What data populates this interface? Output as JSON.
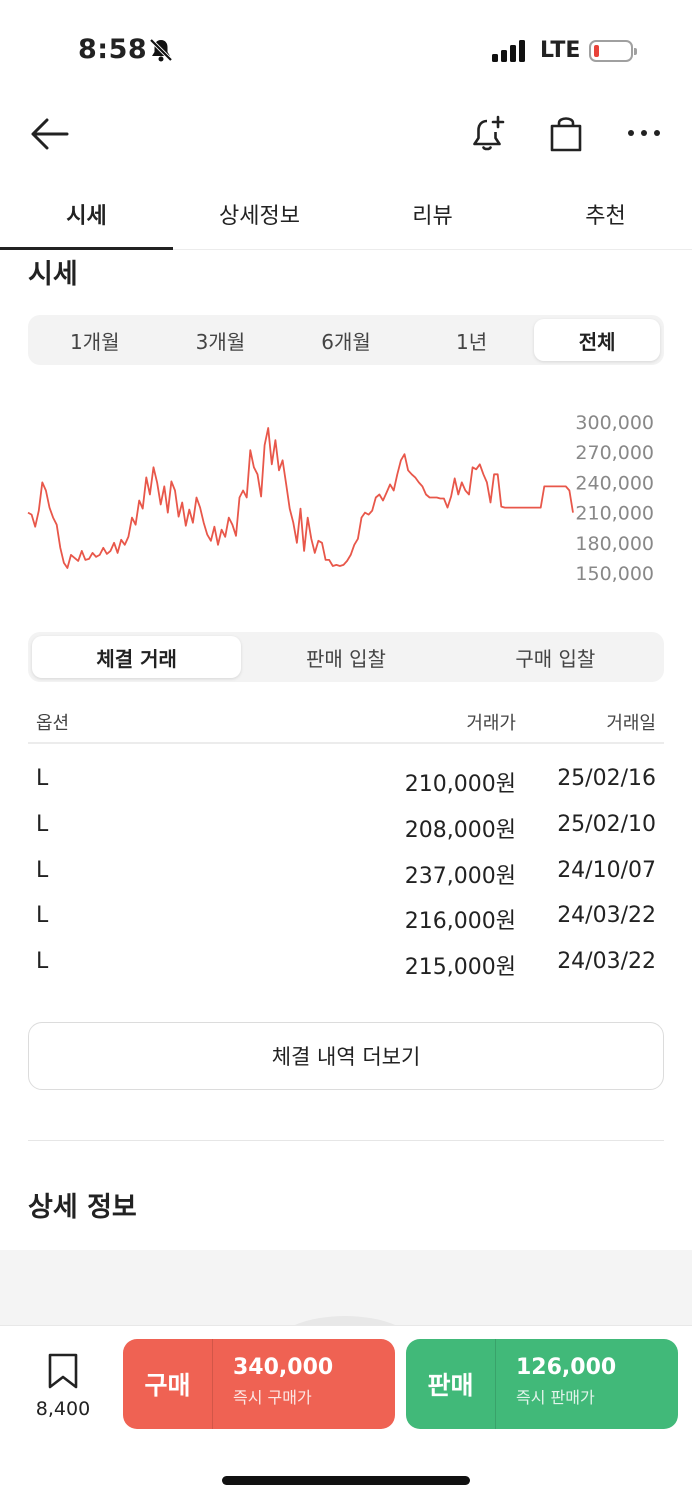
{
  "status": {
    "time": "8:58",
    "network": "LTE"
  },
  "colors": {
    "accent_red": "#ef6253",
    "accent_green": "#41b979",
    "chart_line": "#e8574a"
  },
  "icons": [
    "back-arrow-icon",
    "bell-plus-icon",
    "shopping-bag-icon",
    "more-icon",
    "bookmark-icon",
    "bell-off-icon"
  ],
  "tabs": [
    {
      "label": "시세",
      "active": true
    },
    {
      "label": "상세정보",
      "active": false
    },
    {
      "label": "리뷰",
      "active": false
    },
    {
      "label": "추천",
      "active": false
    }
  ],
  "price_section": {
    "title": "시세"
  },
  "periods": [
    {
      "label": "1개월"
    },
    {
      "label": "3개월"
    },
    {
      "label": "6개월"
    },
    {
      "label": "1년"
    },
    {
      "label": "전체",
      "active": true
    }
  ],
  "chart_data": {
    "type": "line",
    "title": "",
    "xlabel": "",
    "ylabel": "",
    "yticks": [
      "300,000",
      "270,000",
      "240,000",
      "210,000",
      "180,000",
      "150,000"
    ],
    "ylim": [
      150000,
      300000
    ],
    "grid": false,
    "series": [
      {
        "values": [
          210000,
          208000,
          196000,
          212000,
          240000,
          232000,
          215000,
          205000,
          198000,
          175000,
          160000,
          155000,
          168000,
          165000,
          162000,
          172000,
          163000,
          164000,
          170000,
          166000,
          168000,
          175000,
          169000,
          172000,
          180000,
          170000,
          183000,
          178000,
          186000,
          205000,
          198000,
          222000,
          214000,
          245000,
          228000,
          255000,
          240000,
          218000,
          236000,
          210000,
          241000,
          232000,
          206000,
          220000,
          197000,
          213000,
          200000,
          225000,
          215000,
          200000,
          188000,
          182000,
          196000,
          178000,
          193000,
          186000,
          205000,
          198000,
          187000,
          225000,
          232000,
          225000,
          272000,
          255000,
          248000,
          226000,
          277000,
          294000,
          258000,
          282000,
          252000,
          262000,
          238000,
          214000,
          200000,
          180000,
          214000,
          172000,
          205000,
          184000,
          170000,
          182000,
          180000,
          163000,
          163000,
          157000,
          158000,
          157000,
          158000,
          162000,
          168000,
          178000,
          184000,
          205000,
          210000,
          208000,
          212000,
          225000,
          228000,
          222000,
          230000,
          238000,
          232000,
          248000,
          262000,
          268000,
          252000,
          248000,
          245000,
          240000,
          236000,
          228000,
          225000,
          225000,
          225000,
          224000,
          224000,
          215000,
          226000,
          244000,
          228000,
          240000,
          232000,
          228000,
          255000,
          253000,
          258000,
          248000,
          240000,
          220000,
          248000,
          248000,
          216000,
          215000,
          215000,
          215000,
          215000,
          215000,
          215000,
          215000,
          215000,
          215000,
          215000,
          215000,
          236000,
          236000,
          236000,
          236000,
          236000,
          236000,
          236000,
          232000,
          210000
        ]
      }
    ]
  },
  "trade_tabs": [
    {
      "label": "체결 거래",
      "active": true
    },
    {
      "label": "판매 입찰",
      "active": false
    },
    {
      "label": "구매 입찰",
      "active": false
    }
  ],
  "table": {
    "headers": {
      "option": "옵션",
      "price": "거래가",
      "date": "거래일"
    },
    "rows": [
      {
        "option": "L",
        "price": "210,000원",
        "date": "25/02/16"
      },
      {
        "option": "L",
        "price": "208,000원",
        "date": "25/02/10"
      },
      {
        "option": "L",
        "price": "237,000원",
        "date": "24/10/07"
      },
      {
        "option": "L",
        "price": "216,000원",
        "date": "24/03/22"
      },
      {
        "option": "L",
        "price": "215,000원",
        "date": "24/03/22"
      }
    ]
  },
  "more_button": "체결 내역 더보기",
  "detail_section": {
    "title": "상세 정보"
  },
  "bottom": {
    "bookmark_count": "8,400",
    "buy": {
      "label": "구매",
      "price": "340,000",
      "sub": "즉시 구매가"
    },
    "sell": {
      "label": "판매",
      "price": "126,000",
      "sub": "즉시 판매가"
    }
  }
}
